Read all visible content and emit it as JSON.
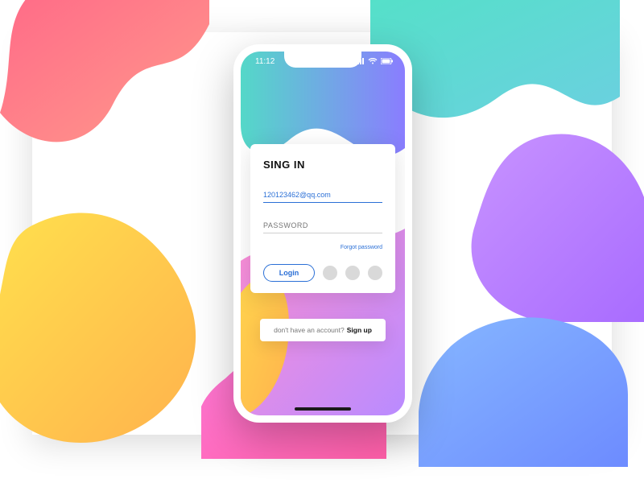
{
  "status": {
    "time": "11:12"
  },
  "card": {
    "title": "SING IN",
    "email_value": "120123462@qq.com",
    "password_placeholder": "PASSWORD",
    "forgot": "Forgot password",
    "login": "Login"
  },
  "signup": {
    "prompt": "don't have an account? ",
    "action": "Sign up"
  }
}
